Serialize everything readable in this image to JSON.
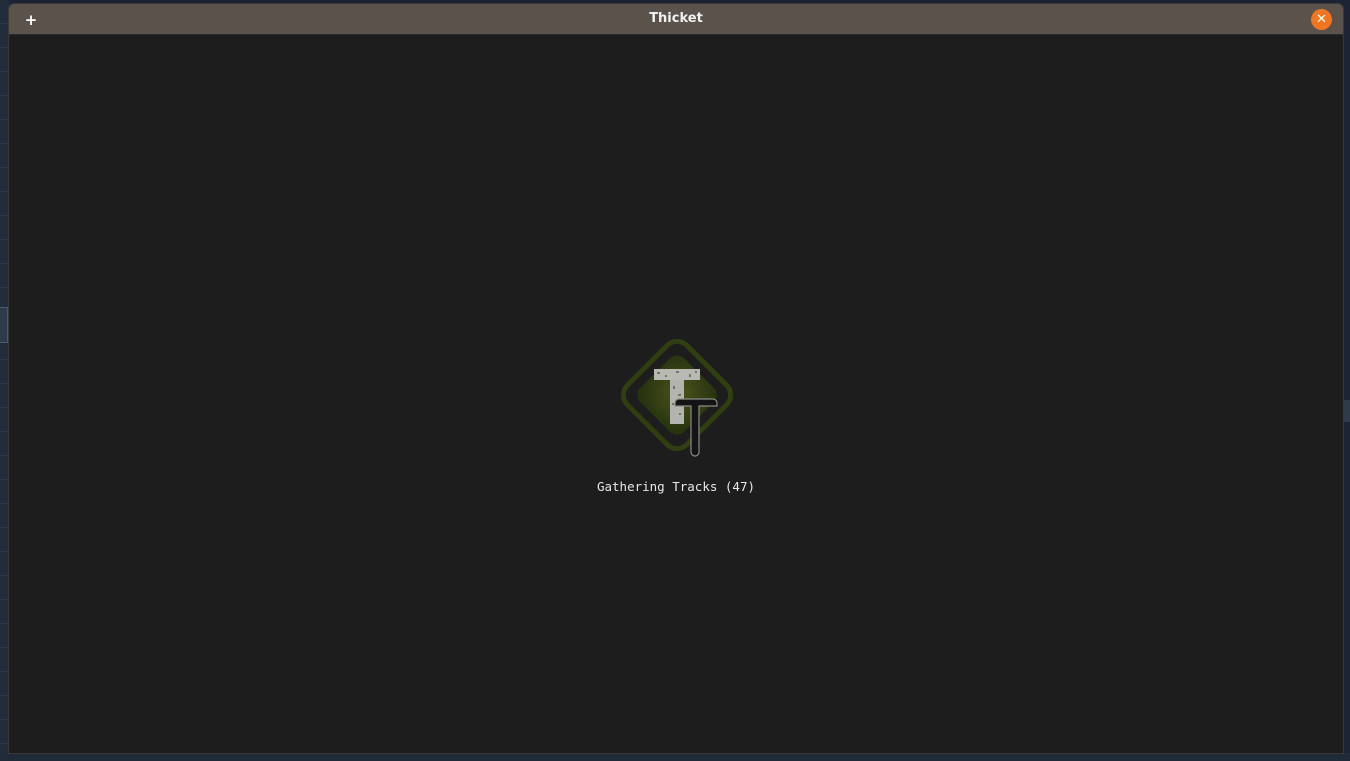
{
  "window": {
    "title": "Thicket",
    "add_label": "+",
    "close_label": "✕"
  },
  "loading": {
    "status": "Gathering Tracks (47)",
    "logo_icon": "thicket-logo-icon"
  },
  "colors": {
    "titlebar": "#5a524b",
    "close_button": "#f2761f",
    "background": "#1d1d1d",
    "logo_green": "#3a4a1c"
  }
}
